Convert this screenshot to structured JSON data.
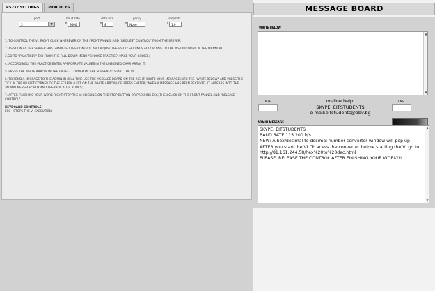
{
  "tabs": [
    "RS232 SETTINGS",
    "PRACTICES"
  ],
  "params": [
    {
      "label": "PORT",
      "value": "3"
    },
    {
      "label": "baud rate",
      "value": "9600"
    },
    {
      "label": "data bits",
      "value": "8"
    },
    {
      "label": "parity",
      "value": "None"
    },
    {
      "label": "stop bits",
      "value": "1.0"
    }
  ],
  "instructions": [
    "1. TO CONTROL THE VI, RIGHT CLICK WHEREVER ON THE FRONT PANNEL AND \"REQUEST CONTROL\" FROM THE SERVER;",
    "2. AS SOON AS THE SERVER HAS GRANETED THE CONTROL AND ADJUST THE RS232 SETTINGS ACCORDING TO THE INSTRUCTIONS IN THE MANNUAL;",
    "3.GO TO \"PRACTICES\" TAB FROM THE FALL DOWN MENU \"CHOOSE PRACTICE\" MAKE YOUR CHOICE;",
    "4. ACCORDINGLY THE PRACTICE ENTER APPROPRIATE VALUES IN THE UNSIGNED CHAR ARRAY it;",
    "5. PRESS THE WHITE ARROW IN THE UP LEFT CORNER OF THE SCREEN TO START THE VI;",
    "6. TO SEND A MESSAGE TO THE ADMIN IN REAL TIME USE THE MESSAGE BOARD ON THE RIGHT: WRITE YOUR MESSAGE INTO THE \"WRITE BELOW\" AND PRESS THE TICK IN THE UP LEFT CORNER OF THE SCREEN (LEFT ON THE WHITE ARROW) OR PRESS ENETER; WHEN A MESSAGE HAS BEEN RECEIVED, IT APPEARS INTO THE \"ADMIN MESSAGE\" BOX AND THE INDICATOR BLINKS;",
    "7. AFTER FINISHING YOUR WORK RIGHT STOP THE VI CLICKING ON THE STOP BUTTON OR PRESSING ESC, THEN CLICK ON THE FRONT PANNEL AND \"RELEASE CONTROL\"."
  ],
  "keyboard": {
    "title": "KEYBOARD CONTROLS:",
    "items": [
      "ESC - STOPS THE VI EXECUTION;"
    ]
  },
  "board": {
    "title": "MESSAGE BOARD",
    "write_label": "WRITE BELOW",
    "date_label": "DATE",
    "time_label": "TIME",
    "help_lines": [
      "on-line help:",
      "SKYPE: EITSTUDENTS",
      "e-mail:eitstudents@abv.bg"
    ],
    "admin_label": "ADMIN MESSAGE",
    "admin_lines": [
      "SKYPE: EITSTUDENTS",
      "BAUD RATE 115 200 b/s",
      "NEW: A hex/decimal to decimal number converter window will pop up AFTER you start the VI. To acess the converter before starting the VI go to: http://81.161.244.58/hex%20to%20dec.html",
      "PLEASE, RELEASE THE CONTROL AFTER FINISHING YOUR WORK!!!"
    ]
  }
}
